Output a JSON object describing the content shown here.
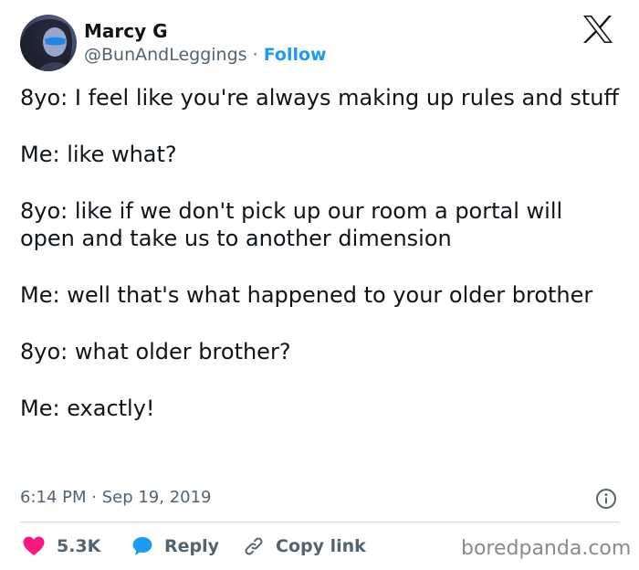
{
  "author": {
    "name": "Marcy G",
    "handle": "@BunAndLeggings",
    "separator": " · ",
    "follow_label": "Follow"
  },
  "tweet": {
    "paragraphs": [
      "8yo: I feel like you're always making up rules and stuff",
      "Me: like what?",
      "8yo: like if we don't pick up our room a portal will open and take us to another dimension",
      "Me: well that's what happened to your older brother",
      "8yo: what older brother?",
      "Me: exactly!"
    ],
    "timestamp": "6:14 PM · Sep 19, 2019"
  },
  "actions": {
    "like_count": "5.3K",
    "reply_label": "Reply",
    "copy_link_label": "Copy link"
  },
  "watermark": "boredpanda.com",
  "colors": {
    "accent": "#1d9bf0",
    "like": "#f91880",
    "reply": "#1d9bf0",
    "text": "#0f1419",
    "secondary": "#536471"
  },
  "icons": {
    "logo": "x-logo-icon",
    "info": "info-icon",
    "like": "heart-icon",
    "reply": "speech-bubble-icon",
    "copy": "link-icon"
  }
}
